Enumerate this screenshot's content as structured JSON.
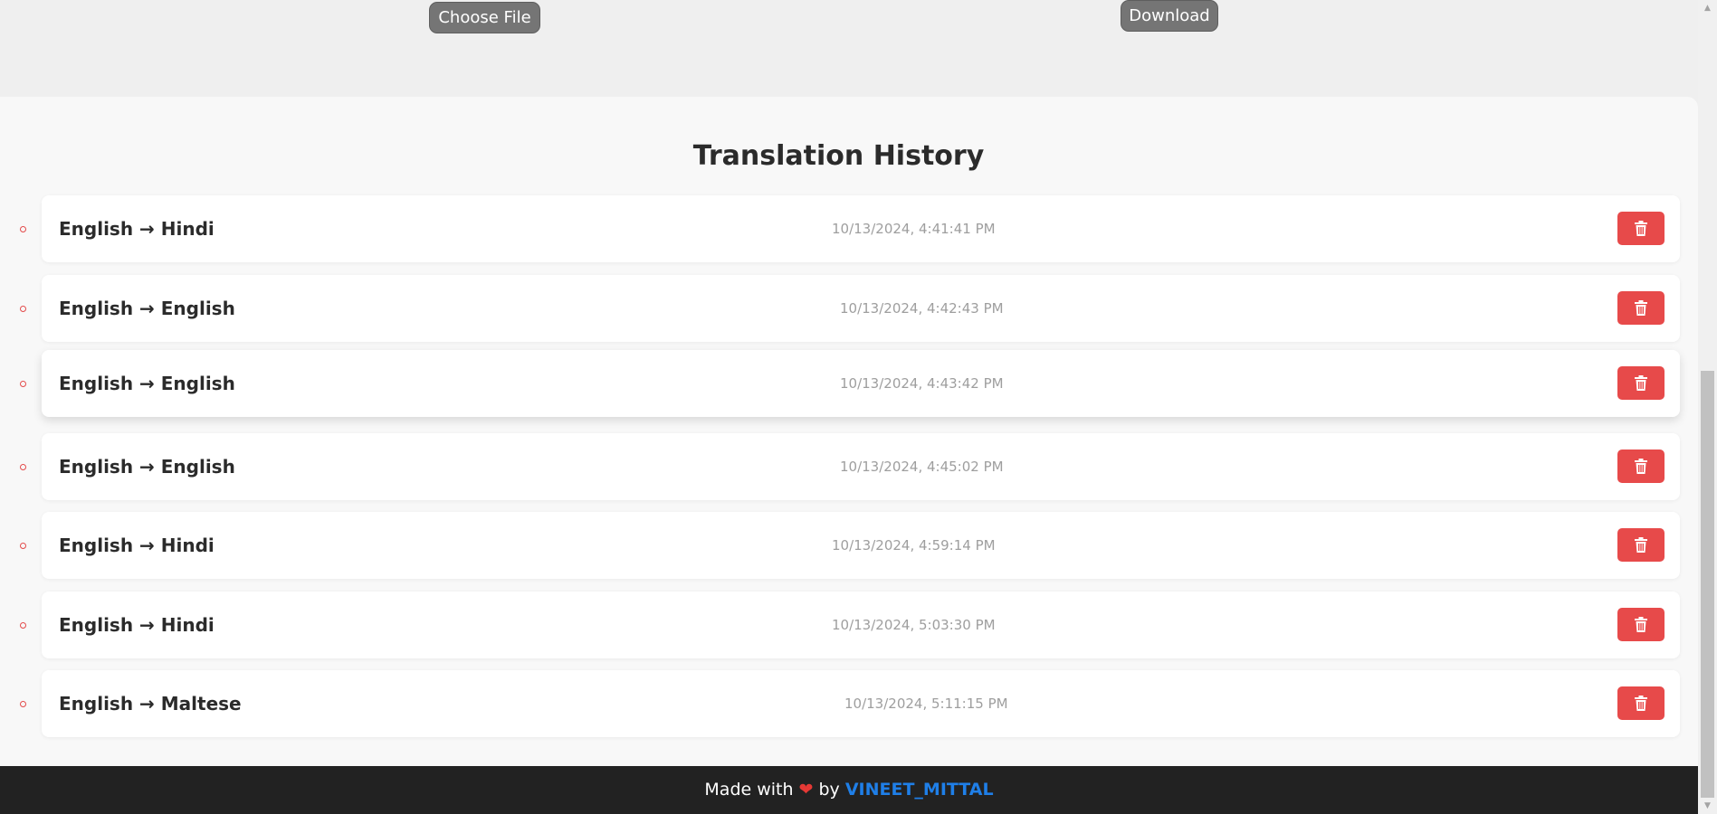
{
  "toolbar": {
    "choose_file_label": "Choose File",
    "download_label": "Download"
  },
  "history": {
    "title": "Translation History",
    "items": [
      {
        "pair": "English → Hindi",
        "time": "10/13/2024, 4:41:41 PM"
      },
      {
        "pair": "English → English",
        "time": "10/13/2024, 4:42:43 PM"
      },
      {
        "pair": "English → English",
        "time": "10/13/2024, 4:43:42 PM"
      },
      {
        "pair": "English → English",
        "time": "10/13/2024, 4:45:02 PM"
      },
      {
        "pair": "English → Hindi",
        "time": "10/13/2024, 4:59:14 PM"
      },
      {
        "pair": "English → Hindi",
        "time": "10/13/2024, 5:03:30 PM"
      },
      {
        "pair": "English → Maltese",
        "time": "10/13/2024, 5:11:15 PM"
      }
    ],
    "delete_icon": "trash-icon"
  },
  "footer": {
    "made_with": "Made with",
    "heart_icon": "heart-icon",
    "by": "by",
    "author": "VINEET_MITTAL"
  },
  "colors": {
    "delete": "#e74a4a",
    "bullet": "#e34a4a",
    "author_link": "#1f7fe8",
    "footer_bg": "#222222"
  }
}
